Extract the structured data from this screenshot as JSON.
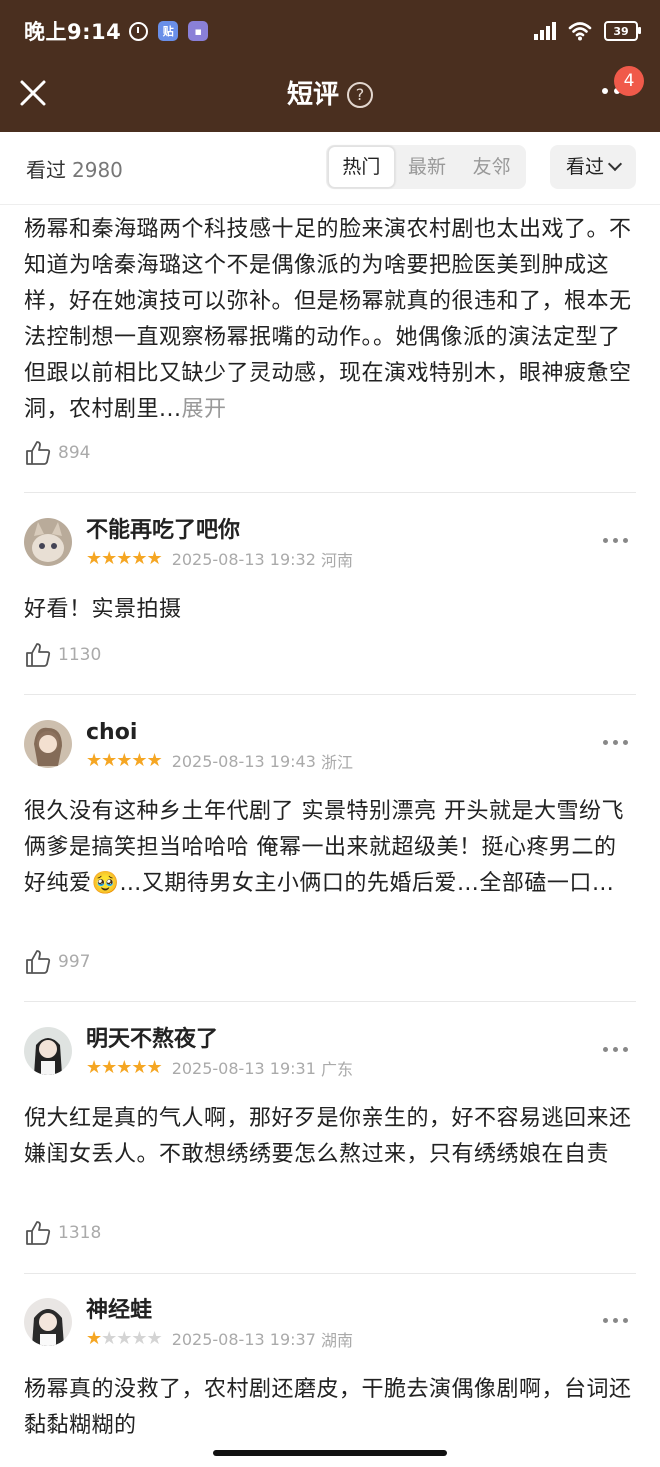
{
  "status_bar": {
    "time": "晚上9:14",
    "battery": "39"
  },
  "nav": {
    "title": "短评",
    "help": "?",
    "badge": "4"
  },
  "filter": {
    "seen_label": "看过",
    "seen_count": "2980",
    "tabs": [
      "热门",
      "最新",
      "友邻"
    ],
    "dropdown_label": "看过"
  },
  "reviews": [
    {
      "text": "杨幂和秦海璐两个科技感十足的脸来演农村剧也太出戏了。不知道为啥秦海璐这个不是偶像派的为啥要把脸医美到肿成这样，好在她演技可以弥补。但是杨幂就真的很违和了，根本无法控制想一直观察杨幂抿嘴的动作。。她偶像派的演法定型了但跟以前相比又缺少了灵动感，现在演戏特别木，眼神疲惫空洞，农村剧里...",
      "expand": "展开",
      "likes": "894"
    },
    {
      "user": "不能再吃了吧你",
      "stars": 5,
      "date": "2025-08-13 19:32",
      "region": "河南",
      "text": "好看！实景拍摄",
      "likes": "1130"
    },
    {
      "user": "choi",
      "stars": 5,
      "date": "2025-08-13 19:43",
      "region": "浙江",
      "text": "很久没有这种乡土年代剧了 实景特别漂亮 开头就是大雪纷飞 俩爹是搞笑担当哈哈哈 俺幂一出来就超级美！挺心疼男二的 好纯爱🥹…又期待男女主小俩口的先婚后爱…全部磕一口…",
      "likes": "997"
    },
    {
      "user": "明天不熬夜了",
      "stars": 5,
      "date": "2025-08-13 19:31",
      "region": "广东",
      "text": "倪大红是真的气人啊，那好歹是你亲生的，好不容易逃回来还嫌闺女丢人。不敢想绣绣要怎么熬过来，只有绣绣娘在自责",
      "likes": "1318"
    },
    {
      "user": "神经蛙",
      "stars": 1,
      "date": "2025-08-13 19:37",
      "region": "湖南",
      "text": "杨幂真的没救了，农村剧还磨皮，干脆去演偶像剧啊，台词还黏黏糊糊的"
    }
  ]
}
